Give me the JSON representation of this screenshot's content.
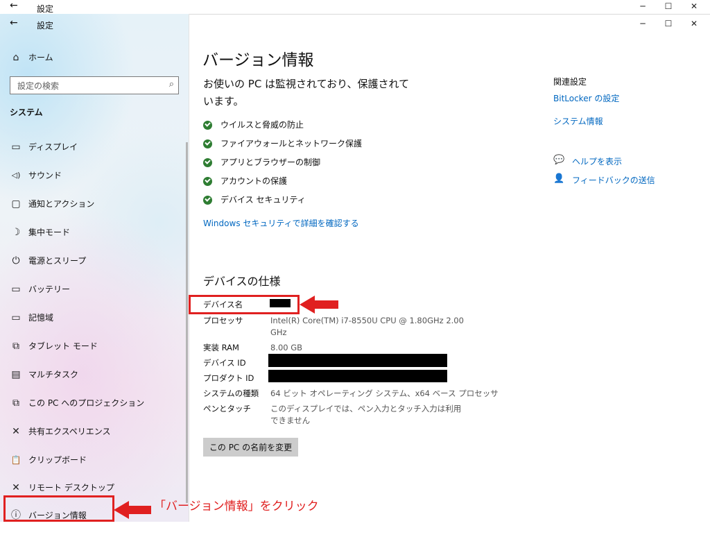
{
  "window": {
    "title": "設定",
    "back_glyph": "←",
    "minimize_glyph": "─",
    "maximize_glyph": "☐",
    "close_glyph": "✕"
  },
  "sidebar": {
    "home_label": "ホーム",
    "search_placeholder": "設定の検索",
    "section_title": "システム",
    "items": [
      {
        "icon": "display-icon",
        "glyph": "▭",
        "label": "ディスプレイ"
      },
      {
        "icon": "sound-icon",
        "glyph": "◁)",
        "label": "サウンド"
      },
      {
        "icon": "notifications-icon",
        "glyph": "▢",
        "label": "通知とアクション"
      },
      {
        "icon": "focus-assist-icon",
        "glyph": "☽",
        "label": "集中モード"
      },
      {
        "icon": "power-icon",
        "glyph": "⏻",
        "label": "電源とスリープ"
      },
      {
        "icon": "battery-icon",
        "glyph": "▭",
        "label": "バッテリー"
      },
      {
        "icon": "storage-icon",
        "glyph": "▭",
        "label": "記憶域"
      },
      {
        "icon": "tablet-mode-icon",
        "glyph": "⧉",
        "label": "タブレット モード"
      },
      {
        "icon": "multitasking-icon",
        "glyph": "▤",
        "label": "マルチタスク"
      },
      {
        "icon": "project-icon",
        "glyph": "⧉",
        "label": "この PC へのプロジェクション"
      },
      {
        "icon": "shared-experiences-icon",
        "glyph": "✕",
        "label": "共有エクスペリエンス"
      },
      {
        "icon": "clipboard-icon",
        "glyph": "📋",
        "label": "クリップボード"
      },
      {
        "icon": "remote-desktop-icon",
        "glyph": "✕",
        "label": "リモート デスクトップ"
      },
      {
        "icon": "about-icon",
        "glyph": "ⓘ",
        "label": "バージョン情報"
      }
    ]
  },
  "main": {
    "title": "バージョン情報",
    "status_text": "お使いの PC は監視されており、保護されています。",
    "protections": [
      "ウイルスと脅威の防止",
      "ファイアウォールとネットワーク保護",
      "アプリとブラウザーの制御",
      "アカウントの保護",
      "デバイス セキュリティ"
    ],
    "security_link": "Windows セキュリティで詳細を確認する",
    "specs_title": "デバイスの仕様",
    "specs": {
      "device_name_label": "デバイス名",
      "processor_label": "プロセッサ",
      "processor_value": "Intel(R) Core(TM) i7-8550U CPU @ 1.80GHz   2.00 GHz",
      "ram_label": "実装 RAM",
      "ram_value": "8.00 GB",
      "device_id_label": "デバイス ID",
      "product_id_label": "プロダクト ID",
      "system_type_label": "システムの種類",
      "system_type_value": "64 ビット オペレーティング システム、x64 ベース プロセッサ",
      "pen_touch_label": "ペンとタッチ",
      "pen_touch_value": "このディスプレイでは、ペン入力とタッチ入力は利用できません"
    },
    "rename_button": "この PC の名前を変更"
  },
  "related": {
    "title": "関連設定",
    "bitlocker_link": "BitLocker の設定",
    "system_info_link": "システム情報",
    "help_link": "ヘルプを表示",
    "feedback_link": "フィードバックの送信"
  },
  "annotation": {
    "text": "「バージョン情報」をクリック",
    "color": "#e02020"
  }
}
